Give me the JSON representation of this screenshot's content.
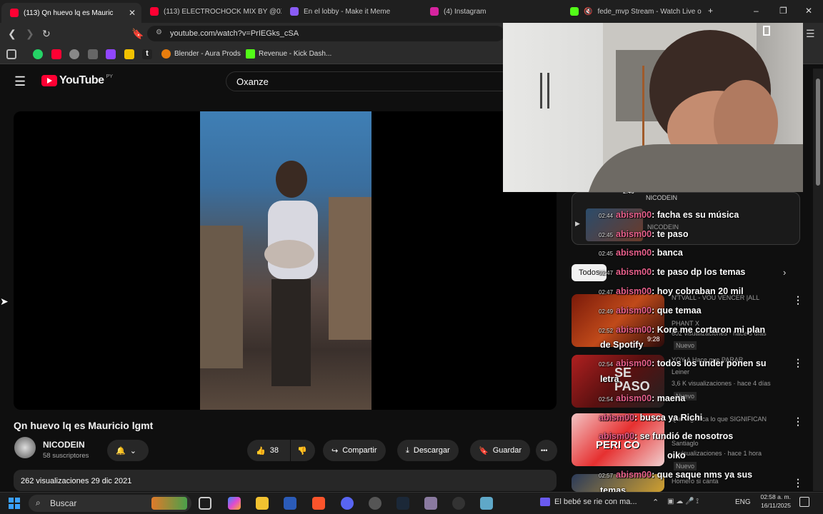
{
  "tabs": [
    {
      "label": "(113) Qn huevo lq es Mauric",
      "color": "#ff0033"
    },
    {
      "label": "(113) ELECTROCHOCK MIX BY @0Xa",
      "color": "#ff0033"
    },
    {
      "label": "En el lobby - Make it Meme",
      "color": "#8a5cf6"
    },
    {
      "label": "(4) Instagram",
      "color": "#d6249f"
    },
    {
      "label": "fede_mvp Stream - Watch Live o",
      "color": "#53fc18"
    }
  ],
  "window": {
    "new_tab": "+",
    "minimize": "–",
    "restore": "❐",
    "close": "✕"
  },
  "url": "youtube.com/watch?v=PrIEGks_cSA",
  "bookmarks": [
    {
      "label": "Blender - Aura Prods",
      "color": "#e87d0d"
    },
    {
      "label": "Revenue - Kick Dash...",
      "color": "#53fc18"
    }
  ],
  "youtube": {
    "logo": "YouTube",
    "region": "PY",
    "search_value": "Oxanze"
  },
  "video": {
    "title": "Qn huevo lq es Mauricio lgmt",
    "channel": "NICODEIN",
    "subscribers": "58 suscriptores",
    "likes": "38",
    "share": "Compartir",
    "download": "Descargar",
    "save": "Guardar",
    "more": "•••",
    "views_date": "262 visualizaciones  29 dic 2021"
  },
  "sidebar": {
    "chip_all": "Todos",
    "rec_channel_top": "NICODEIN",
    "rec_duration_top": "2:46",
    "rec_channel_2": "NICODEIN",
    "rec3_title": "N'TVALL - VOU VENCER |ALL",
    "rec3_channel": "PHANT X",
    "rec3_meta": "602 visualizaciones · hace 3 días",
    "rec3_duration": "9:28",
    "rec3_badge": "Nuevo",
    "rec4_title": "YOY A Hace que PARAR",
    "rec4_channel": "Leiner",
    "rec4_meta": "3,6 K visualizaciones · hace 4 días",
    "rec4_badge": "Nuevo",
    "rec4_thumb_text": "SE PASO",
    "rec5_title": "Que significa lo que SIGNIFICAN",
    "rec5_channel": "Santiaglo",
    "rec5_meta": "visualizaciones · hace 1 hora",
    "rec5_badge": "Nuevo",
    "rec5_thumb_text": "PERI CO",
    "rec6_channel": "Homero si canta"
  },
  "chat": [
    {
      "time": "02:44",
      "user": "abism00",
      "text": ": facha es su música"
    },
    {
      "time": "02:45",
      "user": "abism00",
      "text": ": te paso"
    },
    {
      "time": "02:45",
      "user": "abism00",
      "text": ": banca"
    },
    {
      "time": "02:47",
      "user": "abism00",
      "text": ": te paso dp los temas"
    },
    {
      "time": "02:47",
      "user": "abism00",
      "text": ": hoy cobraban 20 mil"
    },
    {
      "time": "02:49",
      "user": "abism00",
      "text": ": que temaa"
    },
    {
      "time": "02:52",
      "user": "abism00",
      "text": ": Kore me cortaron mi plan"
    },
    {
      "time": "",
      "user": "",
      "text": "de Spotify"
    },
    {
      "time": "02:54",
      "user": "abism00",
      "text": ": todos los under ponen su"
    },
    {
      "time": "",
      "user": "",
      "text": "letra"
    },
    {
      "time": "02:54",
      "user": "abism00",
      "text": ": maena"
    },
    {
      "time": "",
      "user": "abism00",
      "text": ": busca ya Richi"
    },
    {
      "time": "",
      "user": "abism00",
      "text": ": se fundió de nosotros"
    },
    {
      "time": "",
      "user": "",
      "text": "oiko"
    },
    {
      "time": "02:57",
      "user": "abism00",
      "text": ": que saque nms ya sus"
    },
    {
      "time": "",
      "user": "",
      "text": "temas"
    }
  ],
  "taskbar": {
    "search": "Buscar",
    "media": "El bebé se rie con ma...",
    "lang": "ENG",
    "time": "02:58 a. m.",
    "date": "16/11/2025"
  }
}
